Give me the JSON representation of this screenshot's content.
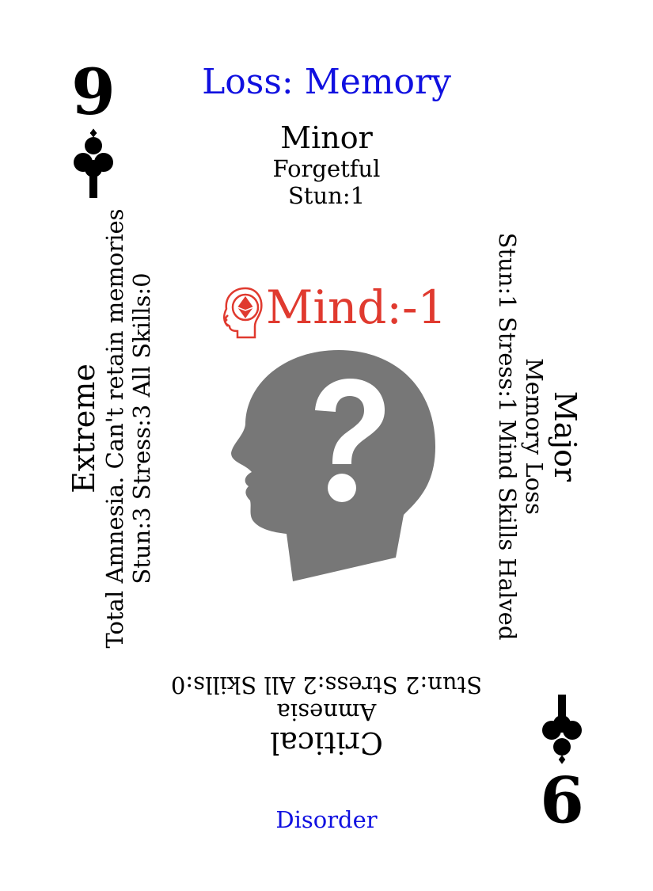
{
  "card": {
    "rank": "9",
    "suit_icon": "club-icon",
    "title": "Loss: Memory",
    "footer": "Disorder",
    "colors": {
      "title": "#1010e0",
      "mind": "#e03a2f",
      "head": "#777777"
    },
    "top": {
      "severity": "Minor",
      "effect": "Forgetful",
      "stats": "Stun:1"
    },
    "right": {
      "severity": "Major",
      "effect": "Memory Loss",
      "stats": "Stun:1 Stress:1 Mind Skills Halved"
    },
    "bottom": {
      "severity": "Critical",
      "effect": "Amnesia",
      "stats": "Stun:2 Stress:2 All Skills:0"
    },
    "left": {
      "severity": "Extreme",
      "effect": "Total Amnesia. Can't retain memories",
      "stats": "Stun:3 Stress:3 All Skills:0"
    },
    "mind": {
      "icon": "mind-head-icon",
      "label": "Mind:-1"
    },
    "center_icon": "question-head-icon"
  }
}
